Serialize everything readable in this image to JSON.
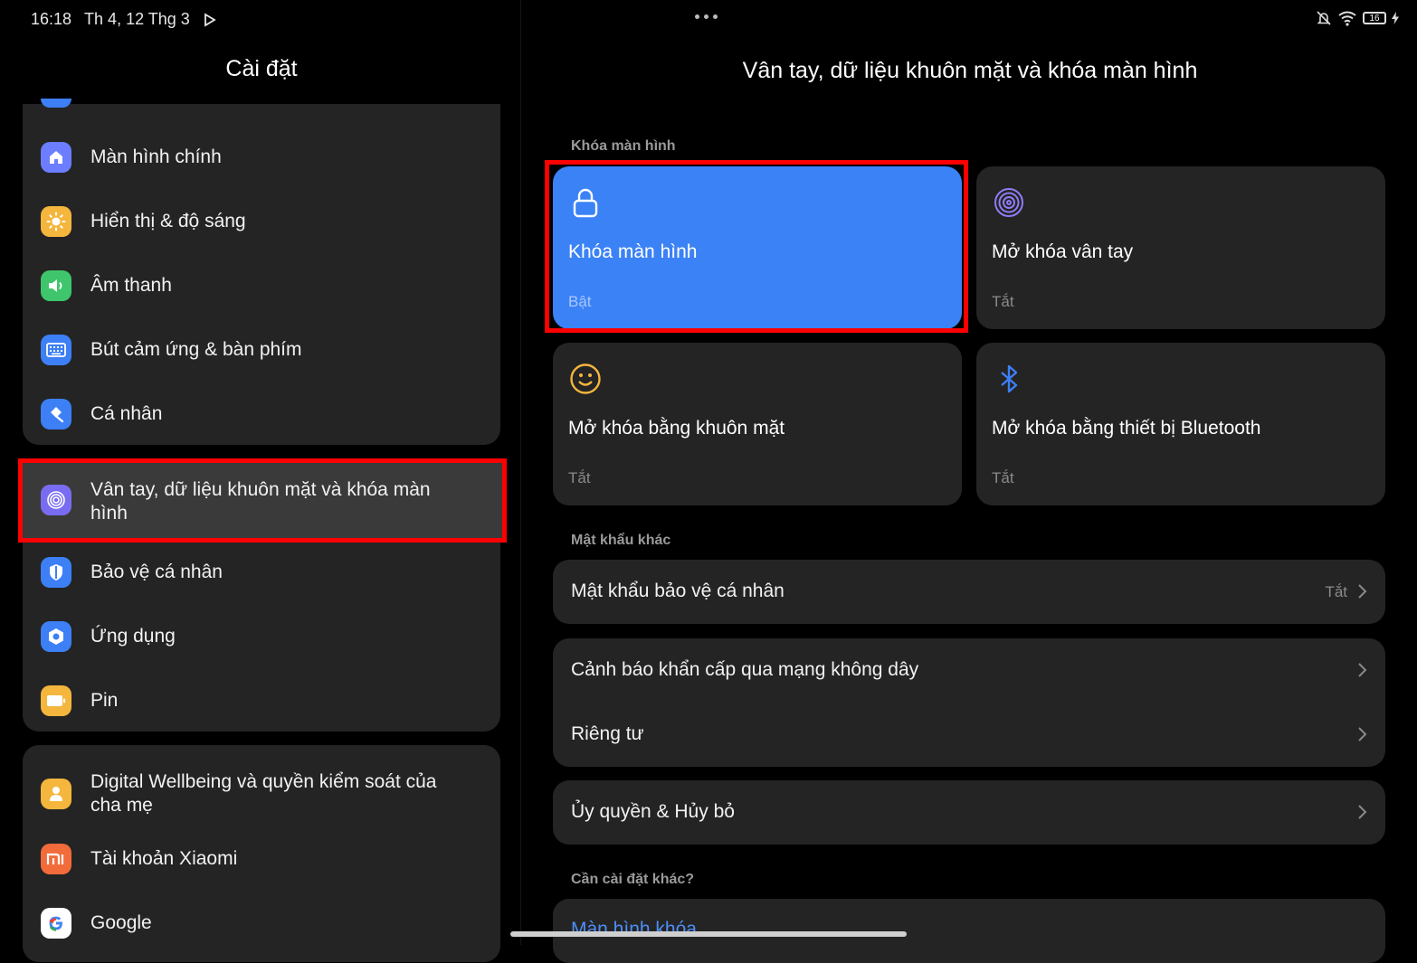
{
  "status": {
    "time": "16:18",
    "date": "Th 4, 12 Thg 3",
    "battery": "16"
  },
  "left": {
    "title": "Cài đặt",
    "items_group1": [
      {
        "label": "Màn hình chính",
        "icon": "home-icon",
        "color": "#6c7dff"
      },
      {
        "label": "Hiển thị & độ sáng",
        "icon": "sun-icon",
        "color": "#f4b63d"
      },
      {
        "label": "Âm thanh",
        "icon": "speaker-icon",
        "color": "#3fc56b"
      },
      {
        "label": "Bút cảm ứng & bàn phím",
        "icon": "keyboard-icon",
        "color": "#3d7ff5"
      },
      {
        "label": "Cá nhân",
        "icon": "brush-icon",
        "color": "#3d7ff5"
      }
    ],
    "selected_item": {
      "label": "Vân tay, dữ liệu khuôn mặt và khóa màn hình",
      "icon": "fingerprint-icon",
      "color": "#7a6cf0"
    },
    "items_group2": [
      {
        "label": "Bảo vệ cá nhân",
        "icon": "shield-icon",
        "color": "#3d7ff5"
      },
      {
        "label": "Ứng dụng",
        "icon": "apps-icon",
        "color": "#3d7ff5"
      },
      {
        "label": "Pin",
        "icon": "battery-icon",
        "color": "#f4b63d"
      }
    ],
    "items_group3": [
      {
        "label": "Digital Wellbeing và quyền kiểm soát của cha mẹ",
        "icon": "wellbeing-icon",
        "color": "#f4b63d"
      },
      {
        "label": "Tài khoản Xiaomi",
        "icon": "mi-icon",
        "color": "#f26b3a"
      },
      {
        "label": "Google",
        "icon": "google-icon",
        "color": "#ffffff"
      }
    ]
  },
  "right": {
    "title": "Vân tay, dữ liệu khuôn mặt và khóa màn hình",
    "section_lock": "Khóa màn hình",
    "cards": [
      {
        "title": "Khóa màn hình",
        "status": "Bật",
        "icon": "lock-icon"
      },
      {
        "title": "Mở khóa vân tay",
        "status": "Tắt",
        "icon": "fingerprint-icon"
      },
      {
        "title": "Mở khóa bằng khuôn mặt",
        "status": "Tắt",
        "icon": "face-icon"
      },
      {
        "title": "Mở khóa bằng thiết bị Bluetooth",
        "status": "Tắt",
        "icon": "bluetooth-icon"
      }
    ],
    "section_other": "Mật khẩu khác",
    "privacy_password": {
      "label": "Mật khẩu bảo vệ cá nhân",
      "value": "Tắt"
    },
    "emergency_alerts": "Cảnh báo khẩn cấp qua mạng không dây",
    "privacy": "Riêng tư",
    "authorization": "Ủy quyền & Hủy bỏ",
    "section_more": "Cần cài đặt khác?",
    "more_link": "Màn hình khóa"
  }
}
